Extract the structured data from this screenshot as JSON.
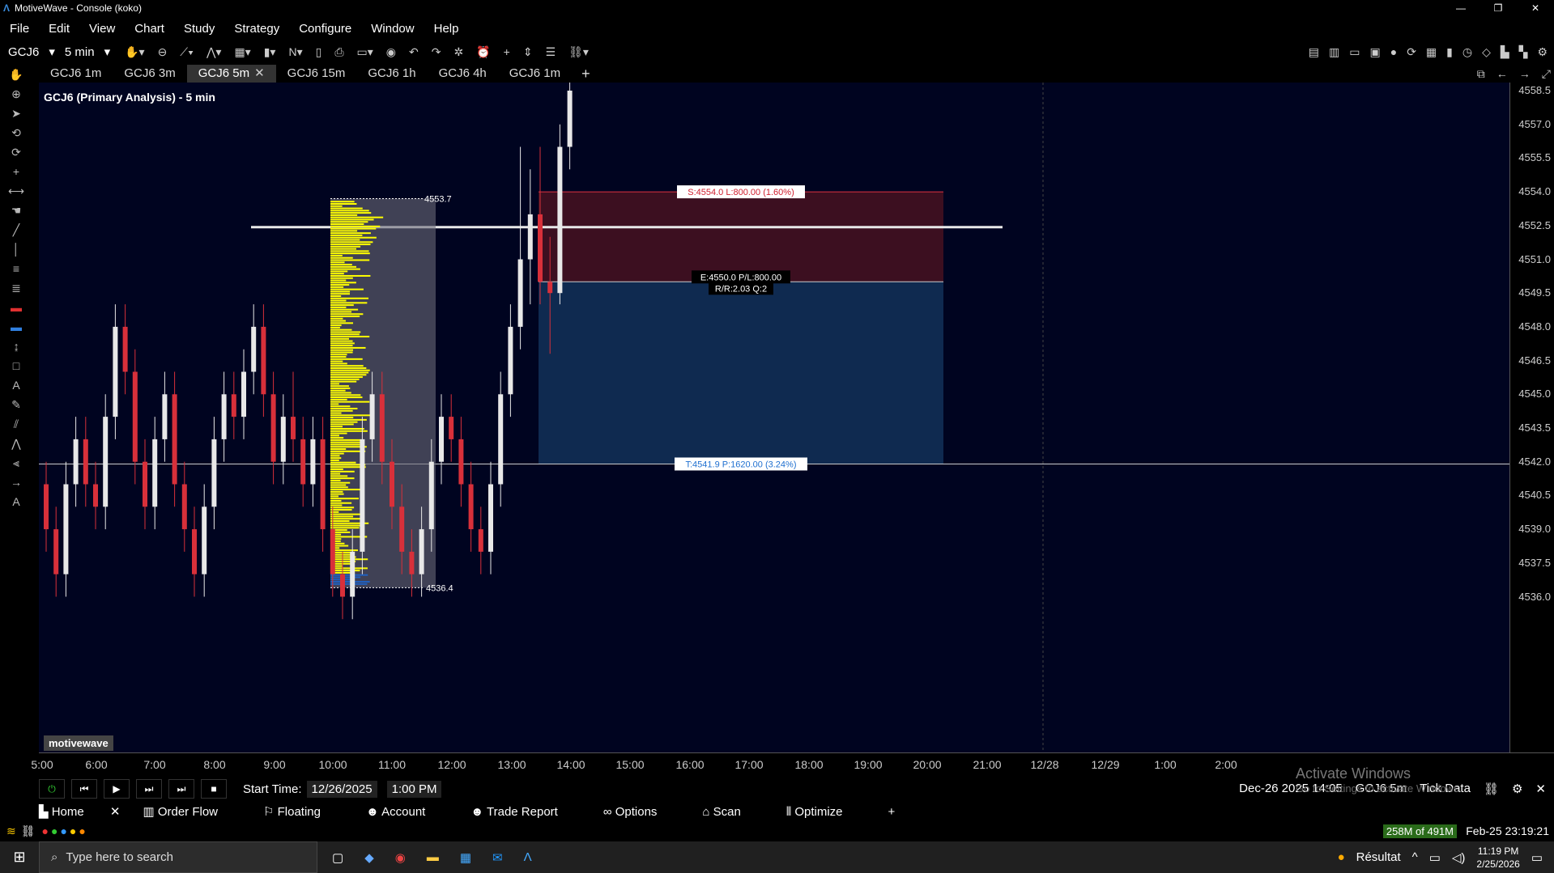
{
  "window": {
    "title": "MotiveWave - Console (koko)",
    "controls": [
      "—",
      "❐",
      "✕"
    ]
  },
  "menu": [
    "File",
    "Edit",
    "View",
    "Chart",
    "Study",
    "Strategy",
    "Configure",
    "Window",
    "Help"
  ],
  "toolbar": {
    "symbol": "GCJ6",
    "interval": "5 min",
    "n_label": "N"
  },
  "tabs": [
    {
      "label": "GCJ6 1m",
      "active": false
    },
    {
      "label": "GCJ6 3m",
      "active": false
    },
    {
      "label": "GCJ6 5m",
      "active": true
    },
    {
      "label": "GCJ6 15m",
      "active": false
    },
    {
      "label": "GCJ6 1h",
      "active": false
    },
    {
      "label": "GCJ6 4h",
      "active": false
    },
    {
      "label": "GCJ6 1m",
      "active": false
    }
  ],
  "chart": {
    "title": "GCJ6 (Primary Analysis) - 5 min",
    "watermark": "motivewave",
    "price_labels": [
      "4558.5",
      "4557.0",
      "4555.5",
      "4554.0",
      "4552.5",
      "4551.0",
      "4549.5",
      "4548.0",
      "4546.5",
      "4545.0",
      "4543.5",
      "4542.0",
      "4540.5",
      "4539.0",
      "4537.5",
      "4536.0"
    ],
    "time_labels": [
      "5:00",
      "6:00",
      "7:00",
      "8:00",
      "9:00",
      "10:00",
      "11:00",
      "12:00",
      "13:00",
      "14:00",
      "15:00",
      "16:00",
      "17:00",
      "18:00",
      "19:00",
      "20:00",
      "21:00",
      "12/28",
      "12/29",
      "1:00",
      "2:00"
    ],
    "stop_label": "S:4554.0 L:800.00 (1.60%)",
    "entry_label_1": "E:4550.0 P/L:800.00",
    "entry_label_2": "R/R:2.03 Q:2",
    "target_label": "T:4541.9 P:1620.00 (3.24%)",
    "profile_high": "4553.7",
    "profile_low": "4536.4"
  },
  "controls": {
    "start_time_label": "Start Time:",
    "start_date": "12/26/2025",
    "start_clock": "1:00 PM",
    "info": "Dec-26 2025 14:05",
    "info_symbol": "GCJ6 5m",
    "info_data": "Tick Data"
  },
  "nav": [
    "Home",
    "Order Flow",
    "Floating",
    "Account",
    "Trade Report",
    "Options",
    "Scan",
    "Optimize"
  ],
  "status": {
    "memory": "258M of 491M",
    "datetime": "Feb-25 23:19:21"
  },
  "activate": {
    "title": "Activate Windows",
    "sub": "Go to Settings to activate Windows."
  },
  "taskbar": {
    "search_placeholder": "Type here to search",
    "weather": "Résultat",
    "time": "11:19 PM",
    "date": "2/25/2026"
  },
  "colors": {
    "background": "#000420",
    "bull": "#e8e8e8",
    "bear": "#d8303a",
    "stop_zone": "#3c0f20",
    "target_zone": "#0f2a50",
    "profile": "#ffff00"
  }
}
